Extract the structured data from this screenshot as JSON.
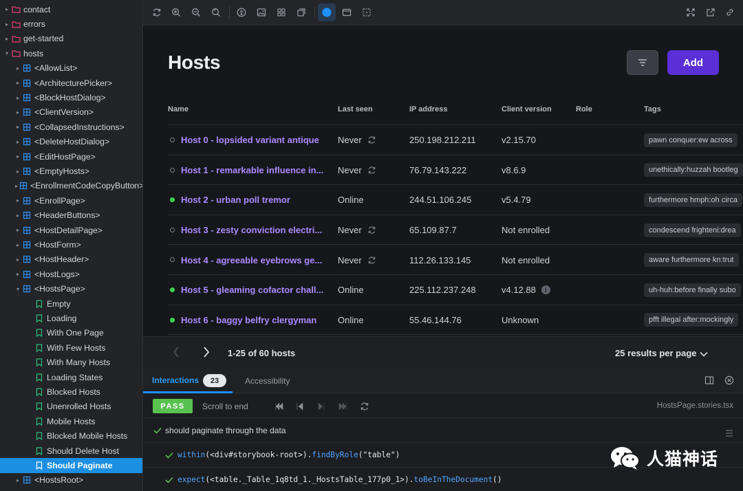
{
  "sidebar": {
    "items": [
      {
        "label": "contact",
        "type": "folder",
        "depth": 0,
        "caret": "right"
      },
      {
        "label": "errors",
        "type": "folder",
        "depth": 0,
        "caret": "right"
      },
      {
        "label": "get-started",
        "type": "folder",
        "depth": 0,
        "caret": "right"
      },
      {
        "label": "hosts",
        "type": "folder",
        "depth": 0,
        "caret": "down"
      },
      {
        "label": "<AllowList>",
        "type": "component",
        "depth": 1,
        "caret": "right"
      },
      {
        "label": "<ArchitecturePicker>",
        "type": "component",
        "depth": 1,
        "caret": "right"
      },
      {
        "label": "<BlockHostDialog>",
        "type": "component",
        "depth": 1,
        "caret": "right"
      },
      {
        "label": "<ClientVersion>",
        "type": "component",
        "depth": 1,
        "caret": "right"
      },
      {
        "label": "<CollapsedInstructions>",
        "type": "component",
        "depth": 1,
        "caret": "right"
      },
      {
        "label": "<DeleteHostDialog>",
        "type": "component",
        "depth": 1,
        "caret": "right"
      },
      {
        "label": "<EditHostPage>",
        "type": "component",
        "depth": 1,
        "caret": "right"
      },
      {
        "label": "<EmptyHosts>",
        "type": "component",
        "depth": 1,
        "caret": "right"
      },
      {
        "label": "<EnrollmentCodeCopyButton>",
        "type": "component",
        "depth": 1,
        "caret": "right"
      },
      {
        "label": "<EnrollPage>",
        "type": "component",
        "depth": 1,
        "caret": "right"
      },
      {
        "label": "<HeaderButtons>",
        "type": "component",
        "depth": 1,
        "caret": "right"
      },
      {
        "label": "<HostDetailPage>",
        "type": "component",
        "depth": 1,
        "caret": "right"
      },
      {
        "label": "<HostForm>",
        "type": "component",
        "depth": 1,
        "caret": "right"
      },
      {
        "label": "<HostHeader>",
        "type": "component",
        "depth": 1,
        "caret": "right"
      },
      {
        "label": "<HostLogs>",
        "type": "component",
        "depth": 1,
        "caret": "right"
      },
      {
        "label": "<HostsPage>",
        "type": "component",
        "depth": 1,
        "caret": "down"
      },
      {
        "label": "Empty",
        "type": "story",
        "depth": 2,
        "caret": ""
      },
      {
        "label": "Loading",
        "type": "story",
        "depth": 2,
        "caret": ""
      },
      {
        "label": "With One Page",
        "type": "story",
        "depth": 2,
        "caret": ""
      },
      {
        "label": "With Few Hosts",
        "type": "story",
        "depth": 2,
        "caret": ""
      },
      {
        "label": "With Many Hosts",
        "type": "story",
        "depth": 2,
        "caret": ""
      },
      {
        "label": "Loading States",
        "type": "story",
        "depth": 2,
        "caret": ""
      },
      {
        "label": "Blocked Hosts",
        "type": "story",
        "depth": 2,
        "caret": ""
      },
      {
        "label": "Unenrolled Hosts",
        "type": "story",
        "depth": 2,
        "caret": ""
      },
      {
        "label": "Mobile Hosts",
        "type": "story",
        "depth": 2,
        "caret": ""
      },
      {
        "label": "Blocked Mobile Hosts",
        "type": "story",
        "depth": 2,
        "caret": ""
      },
      {
        "label": "Should Delete Host",
        "type": "story",
        "depth": 2,
        "caret": ""
      },
      {
        "label": "Should Paginate",
        "type": "story",
        "depth": 2,
        "caret": "",
        "selected": true
      },
      {
        "label": "<HostsRoot>",
        "type": "component",
        "depth": 1,
        "caret": "right"
      }
    ]
  },
  "toolbar": {
    "left_icons": [
      "reload-icon",
      "zoom-in-icon",
      "zoom-out-icon",
      "zoom-reset-icon",
      "accessibility-icon",
      "background-icon",
      "grid-icon",
      "outline-icon",
      "theme-icon",
      "viewport-icon",
      "measure-icon"
    ],
    "right_icons": [
      "fullscreen-icon",
      "open-new-tab-icon",
      "copy-link-icon"
    ]
  },
  "page": {
    "title": "Hosts",
    "add_label": "Add"
  },
  "table": {
    "headers": [
      "Name",
      "Last seen",
      "IP address",
      "Client version",
      "Role",
      "Tags"
    ],
    "rows": [
      {
        "name": "Host 0 - lopsided variant antique",
        "status": "never",
        "last_seen": "Never",
        "ip": "250.198.212.211",
        "version": "v2.15.70",
        "version_info": false,
        "tag": "pawn conquer:ew across"
      },
      {
        "name": "Host 1 - remarkable influence in...",
        "status": "never",
        "last_seen": "Never",
        "ip": "76.79.143.222",
        "version": "v8.6.9",
        "version_info": false,
        "tag": "unethically:huzzah bootleg"
      },
      {
        "name": "Host 2 - urban poll tremor",
        "status": "online",
        "last_seen": "Online",
        "ip": "244.51.106.245",
        "version": "v5.4.79",
        "version_info": false,
        "tag": "furthermore hmph:oh circa"
      },
      {
        "name": "Host 3 - zesty conviction electri...",
        "status": "never",
        "last_seen": "Never",
        "ip": "65.109.87.7",
        "version": "Not enrolled",
        "version_info": false,
        "tag": "condescend frighteni:drea"
      },
      {
        "name": "Host 4 - agreeable eyebrows ge...",
        "status": "never",
        "last_seen": "Never",
        "ip": "112.26.133.145",
        "version": "Not enrolled",
        "version_info": false,
        "tag": "aware furthermore kn:trut"
      },
      {
        "name": "Host 5 - gleaming cofactor chall...",
        "status": "online",
        "last_seen": "Online",
        "ip": "225.112.237.248",
        "version": "v4.12.88",
        "version_info": true,
        "tag": "uh-huh:before finally subo"
      },
      {
        "name": "Host 6 - baggy belfry clergyman",
        "status": "online",
        "last_seen": "Online",
        "ip": "55.46.144.76",
        "version": "Unknown",
        "version_info": false,
        "tag": "pfft illegal after:mockingly"
      }
    ]
  },
  "pager": {
    "range": "1-25 of 60 hosts",
    "per_page": "25 results per page"
  },
  "addon": {
    "tab_interactions": "Interactions",
    "interaction_count": "23",
    "tab_accessibility": "Accessibility",
    "status": "PASS",
    "scroll_label": "Scroll to end",
    "story_file": "HostsPage.stories.tsx",
    "step_title": "should paginate through the data",
    "steps": [
      {
        "fn": "within",
        "args": "(<div#storybook-root>).",
        "fn2": "findByRole",
        "args2": "(\"table\")"
      },
      {
        "fn": "expect",
        "args": "(<table._Table_1q8td_1._HostsTable_177p0_1>).",
        "fn2": "toBeInTheDocument",
        "args2": "()"
      }
    ]
  },
  "watermark": {
    "text": "人猫神话"
  },
  "colors": {
    "accent": "#1c8fe2",
    "primary_button": "#5a2fd6",
    "link": "#a98bff",
    "online": "#39d353",
    "pass": "#58c14f"
  }
}
